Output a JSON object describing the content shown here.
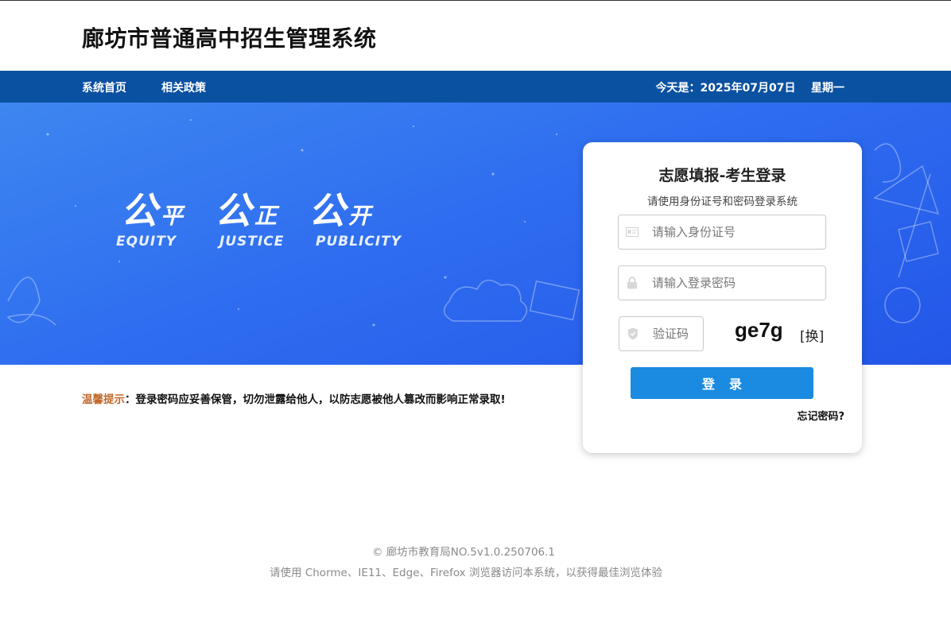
{
  "header": {
    "title": "廊坊市普通高中招生管理系统"
  },
  "nav": {
    "items": [
      "系统首页",
      "相关政策"
    ],
    "date_text": "今天是：2025年07月07日    星期一"
  },
  "banner": {
    "slogans": [
      {
        "big": "公",
        "small": "平",
        "en": "EQUITY"
      },
      {
        "big": "公",
        "small": "正",
        "en": "JUSTICE"
      },
      {
        "big": "公",
        "small": "开",
        "en": "PUBLICITY"
      }
    ]
  },
  "tip": {
    "label": "温馨提示",
    "text": "：登录密码应妥善保管，切勿泄露给他人，以防志愿被他人篡改而影响正常录取!"
  },
  "login": {
    "title": "志愿填报-考生登录",
    "subtitle": "请使用身份证号和密码登录系统",
    "id_placeholder": "请输入身份证号",
    "id_value": "",
    "password_placeholder": "请输入登录密码",
    "password_value": "",
    "captcha_placeholder": "验证码",
    "captcha_value": "",
    "captcha_text": "ge7g",
    "refresh_label": "[换]",
    "submit_label": "登录",
    "forgot_label": "忘记密码?"
  },
  "footer": {
    "copyright": "©  廊坊市教育局NO.5v1.0.250706.1",
    "browser_note": "请使用 Chorme、IE11、Edge、Firefox 浏览器访问本系统，以获得最佳浏览体验"
  },
  "colors": {
    "nav_bg": "#0b51a1",
    "banner_bg": "#2f6ef0",
    "button_bg": "#1a8be0",
    "tip_label": "#c0682a"
  },
  "icons": [
    "id-card-icon",
    "lock-icon",
    "shield-icon"
  ]
}
